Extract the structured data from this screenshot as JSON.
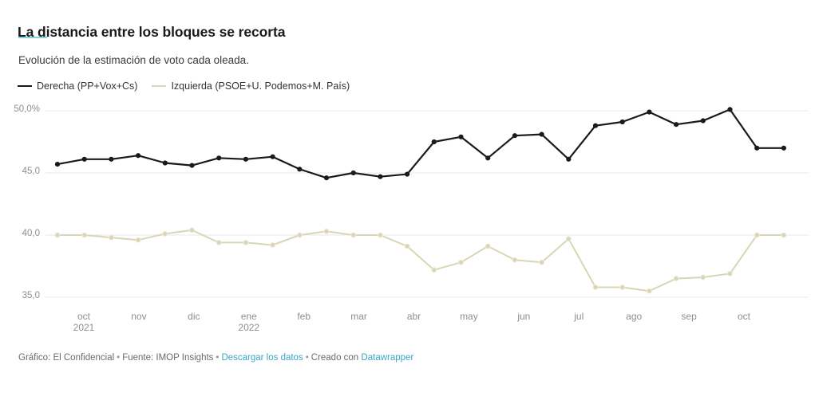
{
  "header": {
    "title": "La distancia entre los bloques se recorta",
    "subtitle": "Evolución de la estimación de voto cada oleada.",
    "accent_color": "#7fd4d4"
  },
  "legend": {
    "position": "top-left",
    "items": [
      {
        "label": "Derecha (PP+Vox+Cs)",
        "color": "#1a1a1a"
      },
      {
        "label": "Izquierda (PSOE+U. Podemos+M. País)",
        "color": "#d9d5b5"
      }
    ]
  },
  "footer": {
    "source_text": "Gráfico: El Confidencial",
    "data_source_text": "Fuente: IMOP Insights",
    "download_link": "Descargar los datos",
    "created_with": "Creado con",
    "tool_link": "Datawrapper",
    "separator": "•",
    "link_color": "#3ba7c4"
  },
  "chart_data": {
    "type": "line",
    "title": "La distancia entre los bloques se recorta",
    "subtitle": "Evolución de la estimación de voto cada oleada.",
    "xlabel": "",
    "ylabel": "",
    "ylim": [
      34.0,
      51.0
    ],
    "yticks": [
      50.0,
      45.0,
      40.0,
      35.0
    ],
    "ytick_labels": [
      "50,0%",
      "45,0",
      "40,0",
      "35,0"
    ],
    "grid": "horizontal",
    "x_axis_type": "time",
    "xtick_labels": [
      {
        "month": "oct",
        "year": "2021"
      },
      {
        "month": "nov",
        "year": ""
      },
      {
        "month": "dic",
        "year": ""
      },
      {
        "month": "ene",
        "year": "2022"
      },
      {
        "month": "feb",
        "year": ""
      },
      {
        "month": "mar",
        "year": ""
      },
      {
        "month": "abr",
        "year": ""
      },
      {
        "month": "may",
        "year": ""
      },
      {
        "month": "jun",
        "year": ""
      },
      {
        "month": "jul",
        "year": ""
      },
      {
        "month": "ago",
        "year": ""
      },
      {
        "month": "sep",
        "year": ""
      },
      {
        "month": "oct",
        "year": ""
      }
    ],
    "n_points": 28,
    "series": [
      {
        "name": "Derecha (PP+Vox+Cs)",
        "color": "#1a1a1a",
        "markers": true,
        "values": [
          45.7,
          46.1,
          46.1,
          46.4,
          45.8,
          45.6,
          46.2,
          46.1,
          46.3,
          45.3,
          44.6,
          45.0,
          44.7,
          44.9,
          47.5,
          47.9,
          46.2,
          48.0,
          48.1,
          46.1,
          48.8,
          49.1,
          49.9,
          48.9,
          49.2,
          50.1,
          47.0,
          47.0
        ]
      },
      {
        "name": "Izquierda (PSOE+U. Podemos+M. País)",
        "color": "#d9d5b5",
        "markers": true,
        "values": [
          40.0,
          40.0,
          39.8,
          39.6,
          40.1,
          40.4,
          39.4,
          39.4,
          39.2,
          40.0,
          40.3,
          40.0,
          40.0,
          39.1,
          37.2,
          37.8,
          39.1,
          38.0,
          37.8,
          39.7,
          35.8,
          35.8,
          35.5,
          36.5,
          36.6,
          36.9,
          40.0,
          40.0
        ]
      }
    ]
  }
}
